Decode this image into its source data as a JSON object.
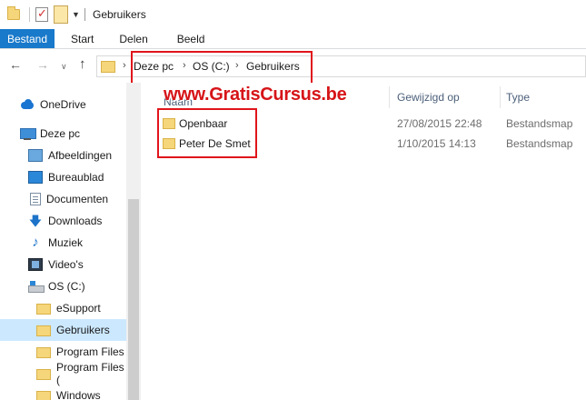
{
  "window": {
    "title": "Gebruikers"
  },
  "ribbon": {
    "tabs": [
      "Bestand",
      "Start",
      "Delen",
      "Beeld"
    ]
  },
  "address": {
    "crumbs": [
      "Deze pc",
      "OS (C:)",
      "Gebruikers"
    ]
  },
  "sidebar": {
    "items": [
      {
        "label": "OneDrive",
        "icon": "onedrive-icon"
      },
      {
        "label": "Deze pc",
        "icon": "computer-icon"
      },
      {
        "label": "Afbeeldingen",
        "icon": "pictures-icon"
      },
      {
        "label": "Bureaublad",
        "icon": "desktop-icon"
      },
      {
        "label": "Documenten",
        "icon": "documents-icon"
      },
      {
        "label": "Downloads",
        "icon": "downloads-icon"
      },
      {
        "label": "Muziek",
        "icon": "music-icon"
      },
      {
        "label": "Video's",
        "icon": "videos-icon"
      },
      {
        "label": "OS (C:)",
        "icon": "drive-icon"
      },
      {
        "label": "eSupport",
        "icon": "folder-icon"
      },
      {
        "label": "Gebruikers",
        "icon": "folder-icon",
        "selected": true
      },
      {
        "label": "Program Files",
        "icon": "folder-icon"
      },
      {
        "label": "Program Files (",
        "icon": "folder-icon"
      },
      {
        "label": "Windows",
        "icon": "folder-icon"
      }
    ]
  },
  "main": {
    "watermark": "www.GratisCursus.be",
    "columns": {
      "name": "Naam",
      "modified": "Gewijzigd op",
      "type": "Type"
    },
    "rows": [
      {
        "name": "Openbaar",
        "modified": "27/08/2015 22:48",
        "type": "Bestandsmap"
      },
      {
        "name": "Peter De Smet",
        "modified": "1/10/2015 14:13",
        "type": "Bestandsmap"
      }
    ]
  },
  "colors": {
    "accent": "#1979ca",
    "selection": "#cce8ff",
    "highlight": "#e0151b"
  }
}
